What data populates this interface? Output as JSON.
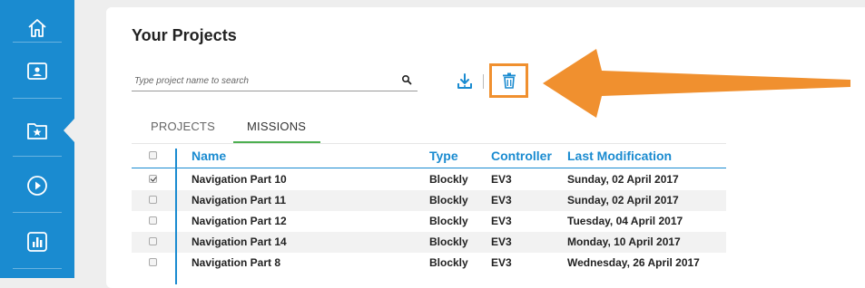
{
  "sidebar": {
    "items": [
      {
        "icon": "home-icon"
      },
      {
        "icon": "profile-folder-icon"
      },
      {
        "icon": "starred-folder-icon",
        "active": true
      },
      {
        "icon": "play-icon"
      },
      {
        "icon": "chart-icon"
      }
    ],
    "color": "#1a8bd0"
  },
  "main": {
    "title": "Your Projects",
    "search": {
      "placeholder": "Type project name to search",
      "value": ""
    },
    "toolbar": {
      "download_icon": "download-icon",
      "delete_icon": "trash-icon"
    },
    "tabs": [
      {
        "label": "PROJECTS",
        "active": false
      },
      {
        "label": "MISSIONS",
        "active": true
      }
    ],
    "table": {
      "headers": {
        "name": "Name",
        "type": "Type",
        "controller": "Controller",
        "modified": "Last Modification"
      },
      "rows": [
        {
          "checked": true,
          "name": "Navigation Part 10",
          "type": "Blockly",
          "controller": "EV3",
          "modified": "Sunday, 02 April 2017"
        },
        {
          "checked": false,
          "name": "Navigation Part 11",
          "type": "Blockly",
          "controller": "EV3",
          "modified": "Sunday, 02 April 2017"
        },
        {
          "checked": false,
          "name": "Navigation Part 12",
          "type": "Blockly",
          "controller": "EV3",
          "modified": "Tuesday, 04 April 2017"
        },
        {
          "checked": false,
          "name": "Navigation Part 14",
          "type": "Blockly",
          "controller": "EV3",
          "modified": "Monday, 10 April 2017"
        },
        {
          "checked": false,
          "name": "Navigation Part 8",
          "type": "Blockly",
          "controller": "EV3",
          "modified": "Wednesday, 26 April 2017"
        }
      ]
    }
  },
  "colors": {
    "accent": "#1a8bd0",
    "highlight": "#f0902f",
    "tab_active": "#4caf50"
  }
}
